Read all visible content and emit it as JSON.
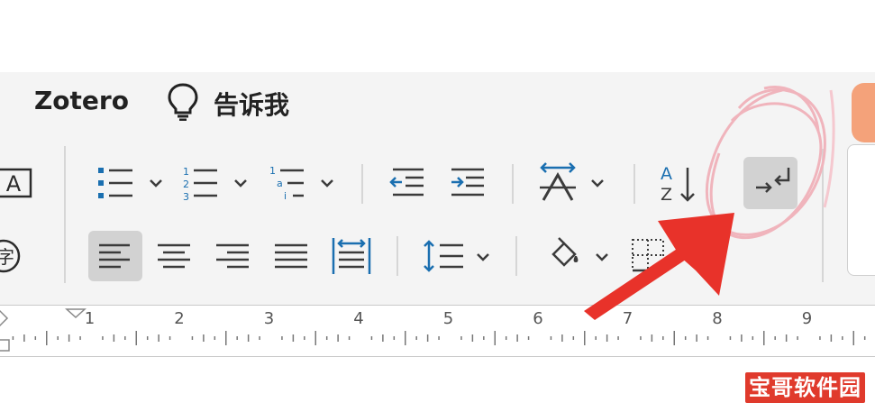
{
  "menu": {
    "zotero_label": "Zotero",
    "tellme_label": "告诉我",
    "tellme_icon": "lightbulb-icon"
  },
  "toolbar": {
    "row1": [
      {
        "icon": "bullet-list-icon",
        "dropdown": true
      },
      {
        "icon": "numbered-list-icon",
        "dropdown": true
      },
      {
        "icon": "multilevel-list-icon",
        "dropdown": true
      },
      {
        "icon": "decrease-indent-icon"
      },
      {
        "icon": "increase-indent-icon"
      },
      {
        "icon": "text-direction-icon",
        "dropdown": true
      },
      {
        "icon": "sort-az-icon"
      },
      {
        "icon": "show-paragraph-marks-icon",
        "state": "selected"
      }
    ],
    "row2": [
      {
        "icon": "align-left-icon",
        "state": "selected"
      },
      {
        "icon": "align-center-icon"
      },
      {
        "icon": "align-right-icon"
      },
      {
        "icon": "justify-icon"
      },
      {
        "icon": "distributed-icon"
      },
      {
        "icon": "line-spacing-icon",
        "dropdown": true
      },
      {
        "icon": "shading-icon",
        "dropdown": true
      },
      {
        "icon": "borders-icon"
      }
    ],
    "left_partial": [
      {
        "icon": "text-box-a-icon",
        "letter": "A"
      },
      {
        "icon": "phonetic-guide-icon",
        "letter": "字"
      }
    ]
  },
  "ruler": {
    "numbers": [
      "1",
      "2",
      "3",
      "4",
      "5",
      "6",
      "7",
      "8",
      "9"
    ]
  },
  "annotations": {
    "highlight": "red-circle-annotation",
    "pointer": "red-arrow-annotation"
  },
  "watermark": {
    "text": "宝哥软件园"
  },
  "colors": {
    "icon_gray": "#3b3b3b",
    "icon_blue": "#1a6fb0",
    "ribbon_bg": "#f4f4f4",
    "selected_bg": "#d2d2d2",
    "annotation_red": "#e8322a",
    "circle_pink": "#f0b4bc",
    "watermark_bg": "#e03a2c"
  }
}
